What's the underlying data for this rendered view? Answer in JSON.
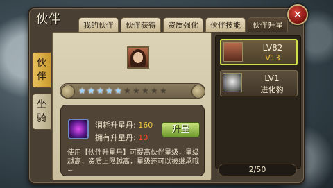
{
  "window": {
    "title": "伙伴"
  },
  "tabs": [
    {
      "label": "我的伙伴",
      "active": false
    },
    {
      "label": "伙伴获得",
      "active": false
    },
    {
      "label": "资质强化",
      "active": false
    },
    {
      "label": "伙伴技能",
      "active": false
    },
    {
      "label": "伙伴升星",
      "active": true
    }
  ],
  "close_icon": "close-icon",
  "side_tabs": [
    {
      "label_top": "伙",
      "label_bottom": "伴",
      "active": true
    },
    {
      "label_top": "坐",
      "label_bottom": "骑",
      "active": false
    }
  ],
  "stars": {
    "filled": 5,
    "total": 10
  },
  "upgrade": {
    "cost_label": "消耗升星丹:",
    "cost_value": "160",
    "owned_label": "拥有升星丹:",
    "owned_value": "10",
    "button_label": "升星",
    "description": "使用【伙伴升星丹】可提高伙伴星级，星级越高，资质上限越高，星级还可以被继承哦~"
  },
  "partners": [
    {
      "level": "LV82",
      "sub": "V13",
      "selected": true
    },
    {
      "level": "LV1",
      "sub": "进化豹",
      "selected": false
    }
  ],
  "pager": {
    "text": "2/50"
  },
  "colors": {
    "accent_gold": "#f0c445",
    "cost_red": "#ff4a2a",
    "selected_border": "#cfe04a",
    "button_green": "#6f9a2c"
  }
}
